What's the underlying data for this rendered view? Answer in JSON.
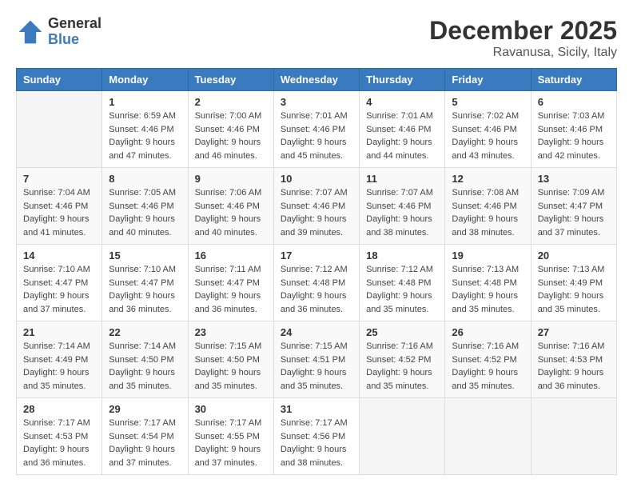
{
  "logo": {
    "text1": "General",
    "text2": "Blue"
  },
  "title": "December 2025",
  "location": "Ravanusa, Sicily, Italy",
  "headers": [
    "Sunday",
    "Monday",
    "Tuesday",
    "Wednesday",
    "Thursday",
    "Friday",
    "Saturday"
  ],
  "weeks": [
    [
      {
        "day": "",
        "sunrise": "",
        "sunset": "",
        "daylight": ""
      },
      {
        "day": "1",
        "sunrise": "Sunrise: 6:59 AM",
        "sunset": "Sunset: 4:46 PM",
        "daylight": "Daylight: 9 hours and 47 minutes."
      },
      {
        "day": "2",
        "sunrise": "Sunrise: 7:00 AM",
        "sunset": "Sunset: 4:46 PM",
        "daylight": "Daylight: 9 hours and 46 minutes."
      },
      {
        "day": "3",
        "sunrise": "Sunrise: 7:01 AM",
        "sunset": "Sunset: 4:46 PM",
        "daylight": "Daylight: 9 hours and 45 minutes."
      },
      {
        "day": "4",
        "sunrise": "Sunrise: 7:01 AM",
        "sunset": "Sunset: 4:46 PM",
        "daylight": "Daylight: 9 hours and 44 minutes."
      },
      {
        "day": "5",
        "sunrise": "Sunrise: 7:02 AM",
        "sunset": "Sunset: 4:46 PM",
        "daylight": "Daylight: 9 hours and 43 minutes."
      },
      {
        "day": "6",
        "sunrise": "Sunrise: 7:03 AM",
        "sunset": "Sunset: 4:46 PM",
        "daylight": "Daylight: 9 hours and 42 minutes."
      }
    ],
    [
      {
        "day": "7",
        "sunrise": "Sunrise: 7:04 AM",
        "sunset": "Sunset: 4:46 PM",
        "daylight": "Daylight: 9 hours and 41 minutes."
      },
      {
        "day": "8",
        "sunrise": "Sunrise: 7:05 AM",
        "sunset": "Sunset: 4:46 PM",
        "daylight": "Daylight: 9 hours and 40 minutes."
      },
      {
        "day": "9",
        "sunrise": "Sunrise: 7:06 AM",
        "sunset": "Sunset: 4:46 PM",
        "daylight": "Daylight: 9 hours and 40 minutes."
      },
      {
        "day": "10",
        "sunrise": "Sunrise: 7:07 AM",
        "sunset": "Sunset: 4:46 PM",
        "daylight": "Daylight: 9 hours and 39 minutes."
      },
      {
        "day": "11",
        "sunrise": "Sunrise: 7:07 AM",
        "sunset": "Sunset: 4:46 PM",
        "daylight": "Daylight: 9 hours and 38 minutes."
      },
      {
        "day": "12",
        "sunrise": "Sunrise: 7:08 AM",
        "sunset": "Sunset: 4:46 PM",
        "daylight": "Daylight: 9 hours and 38 minutes."
      },
      {
        "day": "13",
        "sunrise": "Sunrise: 7:09 AM",
        "sunset": "Sunset: 4:47 PM",
        "daylight": "Daylight: 9 hours and 37 minutes."
      }
    ],
    [
      {
        "day": "14",
        "sunrise": "Sunrise: 7:10 AM",
        "sunset": "Sunset: 4:47 PM",
        "daylight": "Daylight: 9 hours and 37 minutes."
      },
      {
        "day": "15",
        "sunrise": "Sunrise: 7:10 AM",
        "sunset": "Sunset: 4:47 PM",
        "daylight": "Daylight: 9 hours and 36 minutes."
      },
      {
        "day": "16",
        "sunrise": "Sunrise: 7:11 AM",
        "sunset": "Sunset: 4:47 PM",
        "daylight": "Daylight: 9 hours and 36 minutes."
      },
      {
        "day": "17",
        "sunrise": "Sunrise: 7:12 AM",
        "sunset": "Sunset: 4:48 PM",
        "daylight": "Daylight: 9 hours and 36 minutes."
      },
      {
        "day": "18",
        "sunrise": "Sunrise: 7:12 AM",
        "sunset": "Sunset: 4:48 PM",
        "daylight": "Daylight: 9 hours and 35 minutes."
      },
      {
        "day": "19",
        "sunrise": "Sunrise: 7:13 AM",
        "sunset": "Sunset: 4:48 PM",
        "daylight": "Daylight: 9 hours and 35 minutes."
      },
      {
        "day": "20",
        "sunrise": "Sunrise: 7:13 AM",
        "sunset": "Sunset: 4:49 PM",
        "daylight": "Daylight: 9 hours and 35 minutes."
      }
    ],
    [
      {
        "day": "21",
        "sunrise": "Sunrise: 7:14 AM",
        "sunset": "Sunset: 4:49 PM",
        "daylight": "Daylight: 9 hours and 35 minutes."
      },
      {
        "day": "22",
        "sunrise": "Sunrise: 7:14 AM",
        "sunset": "Sunset: 4:50 PM",
        "daylight": "Daylight: 9 hours and 35 minutes."
      },
      {
        "day": "23",
        "sunrise": "Sunrise: 7:15 AM",
        "sunset": "Sunset: 4:50 PM",
        "daylight": "Daylight: 9 hours and 35 minutes."
      },
      {
        "day": "24",
        "sunrise": "Sunrise: 7:15 AM",
        "sunset": "Sunset: 4:51 PM",
        "daylight": "Daylight: 9 hours and 35 minutes."
      },
      {
        "day": "25",
        "sunrise": "Sunrise: 7:16 AM",
        "sunset": "Sunset: 4:52 PM",
        "daylight": "Daylight: 9 hours and 35 minutes."
      },
      {
        "day": "26",
        "sunrise": "Sunrise: 7:16 AM",
        "sunset": "Sunset: 4:52 PM",
        "daylight": "Daylight: 9 hours and 35 minutes."
      },
      {
        "day": "27",
        "sunrise": "Sunrise: 7:16 AM",
        "sunset": "Sunset: 4:53 PM",
        "daylight": "Daylight: 9 hours and 36 minutes."
      }
    ],
    [
      {
        "day": "28",
        "sunrise": "Sunrise: 7:17 AM",
        "sunset": "Sunset: 4:53 PM",
        "daylight": "Daylight: 9 hours and 36 minutes."
      },
      {
        "day": "29",
        "sunrise": "Sunrise: 7:17 AM",
        "sunset": "Sunset: 4:54 PM",
        "daylight": "Daylight: 9 hours and 37 minutes."
      },
      {
        "day": "30",
        "sunrise": "Sunrise: 7:17 AM",
        "sunset": "Sunset: 4:55 PM",
        "daylight": "Daylight: 9 hours and 37 minutes."
      },
      {
        "day": "31",
        "sunrise": "Sunrise: 7:17 AM",
        "sunset": "Sunset: 4:56 PM",
        "daylight": "Daylight: 9 hours and 38 minutes."
      },
      {
        "day": "",
        "sunrise": "",
        "sunset": "",
        "daylight": ""
      },
      {
        "day": "",
        "sunrise": "",
        "sunset": "",
        "daylight": ""
      },
      {
        "day": "",
        "sunrise": "",
        "sunset": "",
        "daylight": ""
      }
    ]
  ]
}
